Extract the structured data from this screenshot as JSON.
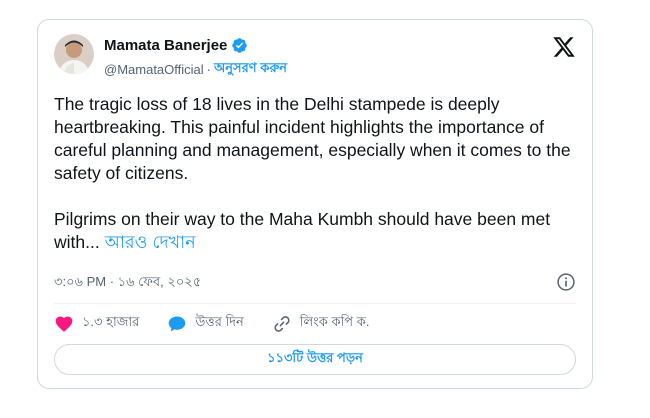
{
  "author": {
    "display_name": "Mamata Banerjee",
    "handle": "@MamataOfficial",
    "separator": "·",
    "follow_label": "অনুসরণ করুন",
    "verified_color": "#1d9bf0"
  },
  "tweet": {
    "paragraph_1": "The tragic loss of 18 lives in the Delhi stampede is deeply heartbreaking. This painful incident highlights the importance of careful planning and management, especially when it comes to the safety of citizens.",
    "paragraph_2": "Pilgrims on their way to the Maha Kumbh should have been met with...",
    "show_more_label": "আরও দেখান"
  },
  "meta": {
    "timestamp": "৩:০৬ PM · ১৬ ফেব, ২০২৫"
  },
  "actions": {
    "like_count": "১.৩ হাজার",
    "reply_label": "উত্তর দিন",
    "copy_link_label": "লিংক কপি ক."
  },
  "read_replies_label": "১১৩টি উত্তর পড়ন",
  "colors": {
    "accent": "#1d9bf0",
    "like": "#f91880",
    "text": "#0f1419",
    "muted": "#536471",
    "border": "#cfd9de"
  },
  "icons": [
    "verified-badge-icon",
    "x-logo-icon",
    "info-icon",
    "heart-icon",
    "reply-icon",
    "link-icon"
  ]
}
